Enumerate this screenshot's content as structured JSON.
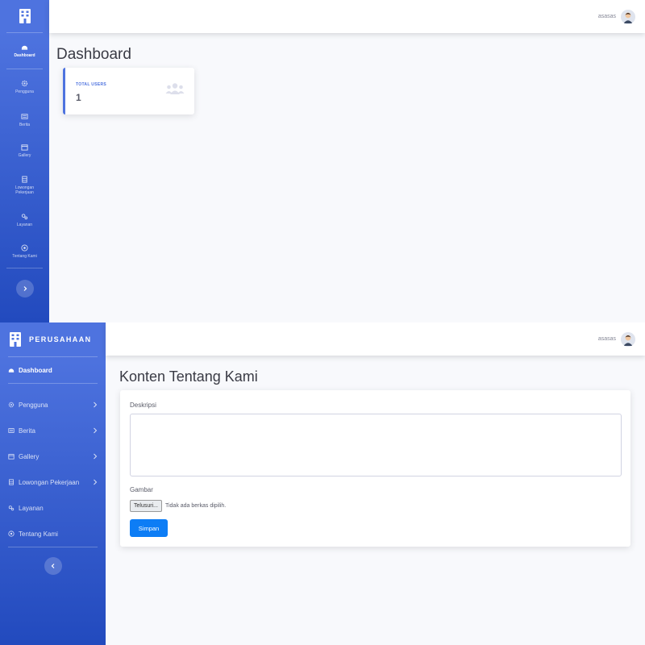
{
  "dashboard_view": {
    "sidebar": {
      "items": [
        {
          "label": "Dashboard",
          "icon": "dashboard-gauge-icon",
          "active": true
        },
        {
          "label": "Pengguna",
          "icon": "cog-icon"
        },
        {
          "label": "Berita",
          "icon": "newspaper-icon"
        },
        {
          "label": "Gallery",
          "icon": "calendar-icon"
        },
        {
          "label": "Lowongan Pekerjaan",
          "icon": "building-icon"
        },
        {
          "label": "Layanan",
          "icon": "cogs-icon"
        },
        {
          "label": "Tentang Kami",
          "icon": "info-circle-icon"
        }
      ],
      "toggle_icon": "chevron-right-icon"
    },
    "topbar": {
      "username": "asasas"
    },
    "page_title": "Dashboard",
    "stat_card": {
      "label": "Total Users",
      "value": "1",
      "icon": "users-icon"
    }
  },
  "about_view": {
    "sidebar": {
      "brand": "PERUSAHAAN",
      "items": [
        {
          "label": "Dashboard",
          "icon": "dashboard-gauge-icon",
          "active": true
        },
        {
          "label": "Pengguna",
          "icon": "cog-icon",
          "chevron": true
        },
        {
          "label": "Berita",
          "icon": "newspaper-icon",
          "chevron": true
        },
        {
          "label": "Gallery",
          "icon": "calendar-icon",
          "chevron": true
        },
        {
          "label": "Lowongan Pekerjaan",
          "icon": "building-icon",
          "chevron": true
        },
        {
          "label": "Layanan",
          "icon": "cogs-icon"
        },
        {
          "label": "Tentang Kami",
          "icon": "info-circle-icon"
        }
      ],
      "toggle_icon": "chevron-left-icon"
    },
    "topbar": {
      "username": "asasas"
    },
    "page_title": "Konten Tentang Kami",
    "form": {
      "description_label": "Deskripsi",
      "description_value": "",
      "image_label": "Gambar",
      "browse_button": "Telusuri...",
      "file_status": "Tidak ada berkas dipilih.",
      "submit_button": "Simpan"
    }
  },
  "colors": {
    "sidebar_top": "#4e73df",
    "sidebar_bottom": "#224abe",
    "primary_button": "#0d7df5",
    "page_background": "#f8f9fc"
  }
}
